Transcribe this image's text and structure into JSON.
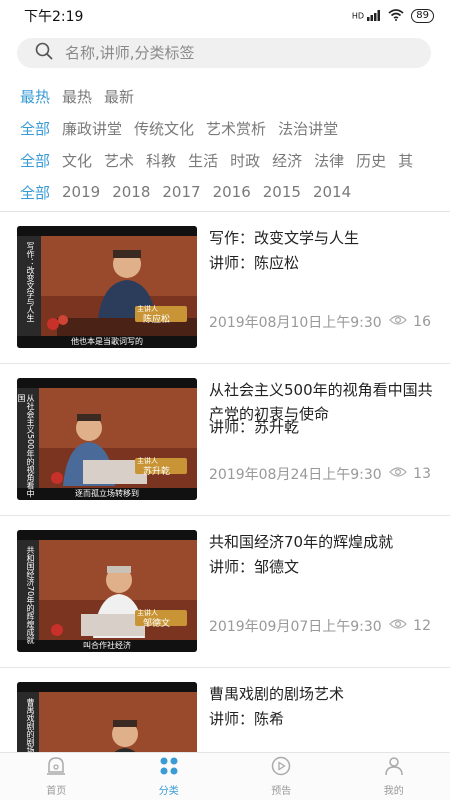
{
  "status_bar": {
    "time": "下午2:19",
    "network": "HD",
    "battery": "89"
  },
  "search": {
    "placeholder": "名称,讲师,分类标签"
  },
  "filters": {
    "sort": [
      "最热",
      "最热",
      "最新"
    ],
    "topic": [
      "全部",
      "廉政讲堂",
      "传统文化",
      "艺术赏析",
      "法治讲堂"
    ],
    "category": [
      "全部",
      "文化",
      "艺术",
      "科教",
      "生活",
      "时政",
      "经济",
      "法律",
      "历史",
      "其"
    ],
    "year": [
      "全部",
      "2019",
      "2018",
      "2017",
      "2016",
      "2015",
      "2014"
    ]
  },
  "items": [
    {
      "title": "写作：改变文学与人生",
      "lecturer": "讲师：陈应松",
      "date": "2019年08月10日上午9:30",
      "views": "16",
      "thumb_side": "写作：改变文学与人生",
      "thumb_badge_top": "主讲人",
      "thumb_badge_name": "陈应松",
      "thumb_caption": "他也本是当歌词写的"
    },
    {
      "title": "从社会主义500年的视角看中国共产党的初衷与使命",
      "lecturer": "讲师：苏升乾",
      "date": "2019年08月24日上午9:30",
      "views": "13",
      "thumb_side": "从社会主义500年的视角看中国",
      "thumb_badge_top": "主讲人",
      "thumb_badge_name": "苏升乾",
      "thumb_caption": "逐而孤立场转移到"
    },
    {
      "title": "共和国经济70年的辉煌成就",
      "lecturer": "讲师：邹德文",
      "date": "2019年09月07日上午9:30",
      "views": "12",
      "thumb_side": "共和国经济70年的辉煌成就",
      "thumb_badge_top": "主讲人",
      "thumb_badge_name": "邹德文",
      "thumb_caption": "叫合作社经济"
    },
    {
      "title": "曹禺戏剧的剧场艺术",
      "lecturer": "讲师：陈希",
      "date": "",
      "views": "",
      "thumb_side": "曹禺戏剧的剧场艺术",
      "thumb_badge_top": "",
      "thumb_badge_name": "",
      "thumb_caption": ""
    }
  ],
  "tabs": [
    {
      "label": "首页",
      "icon": "home-icon"
    },
    {
      "label": "分类",
      "icon": "category-icon"
    },
    {
      "label": "预告",
      "icon": "play-icon"
    },
    {
      "label": "我的",
      "icon": "user-icon"
    }
  ],
  "colors": {
    "accent": "#3a9bd5",
    "muted": "#7a7a7a",
    "meta": "#999999"
  }
}
